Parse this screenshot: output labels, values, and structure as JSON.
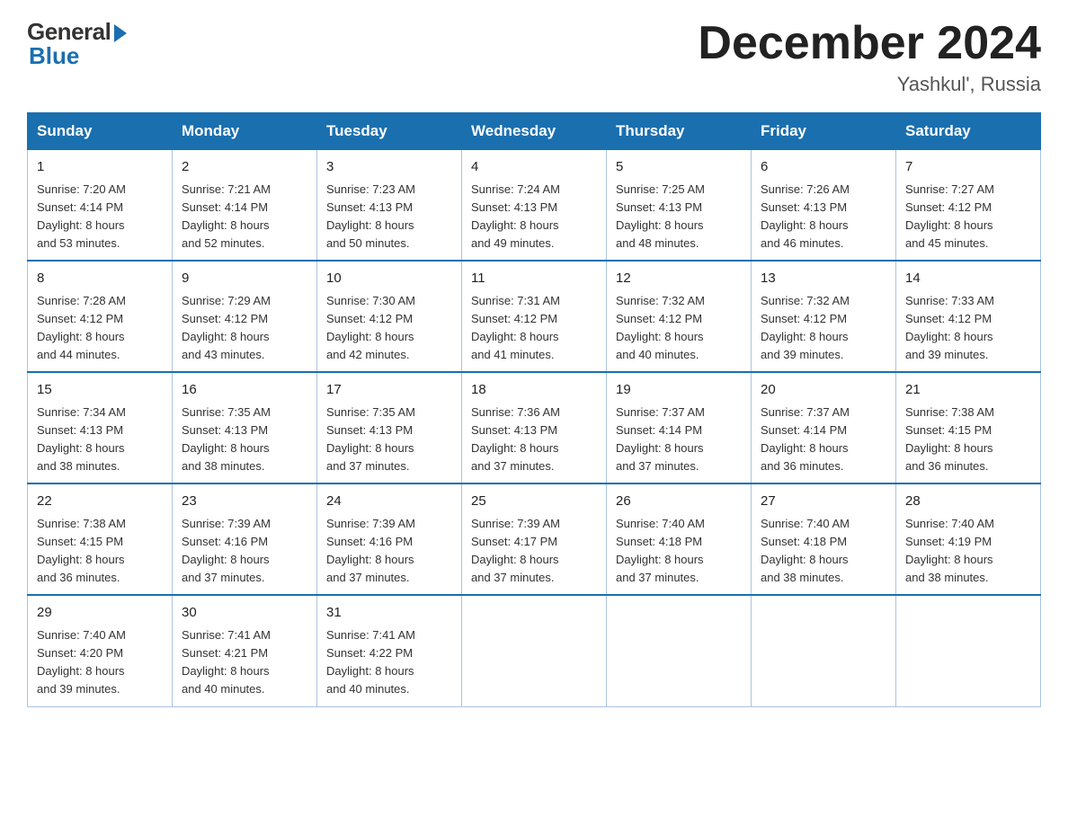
{
  "header": {
    "logo": {
      "general": "General",
      "blue": "Blue"
    },
    "title": "December 2024",
    "location": "Yashkul', Russia"
  },
  "days_of_week": [
    "Sunday",
    "Monday",
    "Tuesday",
    "Wednesday",
    "Thursday",
    "Friday",
    "Saturday"
  ],
  "weeks": [
    [
      {
        "day": "1",
        "sunrise": "7:20 AM",
        "sunset": "4:14 PM",
        "daylight": "8 hours and 53 minutes."
      },
      {
        "day": "2",
        "sunrise": "7:21 AM",
        "sunset": "4:14 PM",
        "daylight": "8 hours and 52 minutes."
      },
      {
        "day": "3",
        "sunrise": "7:23 AM",
        "sunset": "4:13 PM",
        "daylight": "8 hours and 50 minutes."
      },
      {
        "day": "4",
        "sunrise": "7:24 AM",
        "sunset": "4:13 PM",
        "daylight": "8 hours and 49 minutes."
      },
      {
        "day": "5",
        "sunrise": "7:25 AM",
        "sunset": "4:13 PM",
        "daylight": "8 hours and 48 minutes."
      },
      {
        "day": "6",
        "sunrise": "7:26 AM",
        "sunset": "4:13 PM",
        "daylight": "8 hours and 46 minutes."
      },
      {
        "day": "7",
        "sunrise": "7:27 AM",
        "sunset": "4:12 PM",
        "daylight": "8 hours and 45 minutes."
      }
    ],
    [
      {
        "day": "8",
        "sunrise": "7:28 AM",
        "sunset": "4:12 PM",
        "daylight": "8 hours and 44 minutes."
      },
      {
        "day": "9",
        "sunrise": "7:29 AM",
        "sunset": "4:12 PM",
        "daylight": "8 hours and 43 minutes."
      },
      {
        "day": "10",
        "sunrise": "7:30 AM",
        "sunset": "4:12 PM",
        "daylight": "8 hours and 42 minutes."
      },
      {
        "day": "11",
        "sunrise": "7:31 AM",
        "sunset": "4:12 PM",
        "daylight": "8 hours and 41 minutes."
      },
      {
        "day": "12",
        "sunrise": "7:32 AM",
        "sunset": "4:12 PM",
        "daylight": "8 hours and 40 minutes."
      },
      {
        "day": "13",
        "sunrise": "7:32 AM",
        "sunset": "4:12 PM",
        "daylight": "8 hours and 39 minutes."
      },
      {
        "day": "14",
        "sunrise": "7:33 AM",
        "sunset": "4:12 PM",
        "daylight": "8 hours and 39 minutes."
      }
    ],
    [
      {
        "day": "15",
        "sunrise": "7:34 AM",
        "sunset": "4:13 PM",
        "daylight": "8 hours and 38 minutes."
      },
      {
        "day": "16",
        "sunrise": "7:35 AM",
        "sunset": "4:13 PM",
        "daylight": "8 hours and 38 minutes."
      },
      {
        "day": "17",
        "sunrise": "7:35 AM",
        "sunset": "4:13 PM",
        "daylight": "8 hours and 37 minutes."
      },
      {
        "day": "18",
        "sunrise": "7:36 AM",
        "sunset": "4:13 PM",
        "daylight": "8 hours and 37 minutes."
      },
      {
        "day": "19",
        "sunrise": "7:37 AM",
        "sunset": "4:14 PM",
        "daylight": "8 hours and 37 minutes."
      },
      {
        "day": "20",
        "sunrise": "7:37 AM",
        "sunset": "4:14 PM",
        "daylight": "8 hours and 36 minutes."
      },
      {
        "day": "21",
        "sunrise": "7:38 AM",
        "sunset": "4:15 PM",
        "daylight": "8 hours and 36 minutes."
      }
    ],
    [
      {
        "day": "22",
        "sunrise": "7:38 AM",
        "sunset": "4:15 PM",
        "daylight": "8 hours and 36 minutes."
      },
      {
        "day": "23",
        "sunrise": "7:39 AM",
        "sunset": "4:16 PM",
        "daylight": "8 hours and 37 minutes."
      },
      {
        "day": "24",
        "sunrise": "7:39 AM",
        "sunset": "4:16 PM",
        "daylight": "8 hours and 37 minutes."
      },
      {
        "day": "25",
        "sunrise": "7:39 AM",
        "sunset": "4:17 PM",
        "daylight": "8 hours and 37 minutes."
      },
      {
        "day": "26",
        "sunrise": "7:40 AM",
        "sunset": "4:18 PM",
        "daylight": "8 hours and 37 minutes."
      },
      {
        "day": "27",
        "sunrise": "7:40 AM",
        "sunset": "4:18 PM",
        "daylight": "8 hours and 38 minutes."
      },
      {
        "day": "28",
        "sunrise": "7:40 AM",
        "sunset": "4:19 PM",
        "daylight": "8 hours and 38 minutes."
      }
    ],
    [
      {
        "day": "29",
        "sunrise": "7:40 AM",
        "sunset": "4:20 PM",
        "daylight": "8 hours and 39 minutes."
      },
      {
        "day": "30",
        "sunrise": "7:41 AM",
        "sunset": "4:21 PM",
        "daylight": "8 hours and 40 minutes."
      },
      {
        "day": "31",
        "sunrise": "7:41 AM",
        "sunset": "4:22 PM",
        "daylight": "8 hours and 40 minutes."
      },
      null,
      null,
      null,
      null
    ]
  ],
  "labels": {
    "sunrise": "Sunrise:",
    "sunset": "Sunset:",
    "daylight": "Daylight:"
  }
}
